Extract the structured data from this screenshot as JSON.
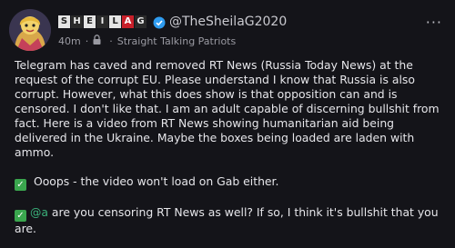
{
  "author": {
    "display_name_letters": [
      "S",
      "H",
      "E",
      "I",
      "L",
      "A",
      "G"
    ],
    "handle": "@TheSheilaG2020"
  },
  "meta": {
    "time": "40m",
    "separator": "·",
    "group": "Straight Talking Patriots"
  },
  "body": {
    "paragraph1": "Telegram has caved and removed RT News (Russia Today News) at the request of the corrupt EU. Please understand I know that Russia is also corrupt. However, what this does show is that opposition can and is censored. I don't like that. I am an adult capable of discerning bullshit from fact. Here is a video from RT News showing humanitarian aid being delivered in the Ukraine. Maybe the boxes being loaded are laden with ammo.",
    "paragraph2_text": " Ooops - the video won't load on Gab either.",
    "paragraph3_mention": "@a",
    "paragraph3_text": " are you censoring RT News as well? If so, I think it's bullshit that you are."
  },
  "icons": {
    "check": "✓",
    "more": "···"
  },
  "colors": {
    "background": "#141419",
    "mention": "#3ab07a",
    "check_bg": "#3aa64e",
    "verified": "#2f9cf0"
  }
}
